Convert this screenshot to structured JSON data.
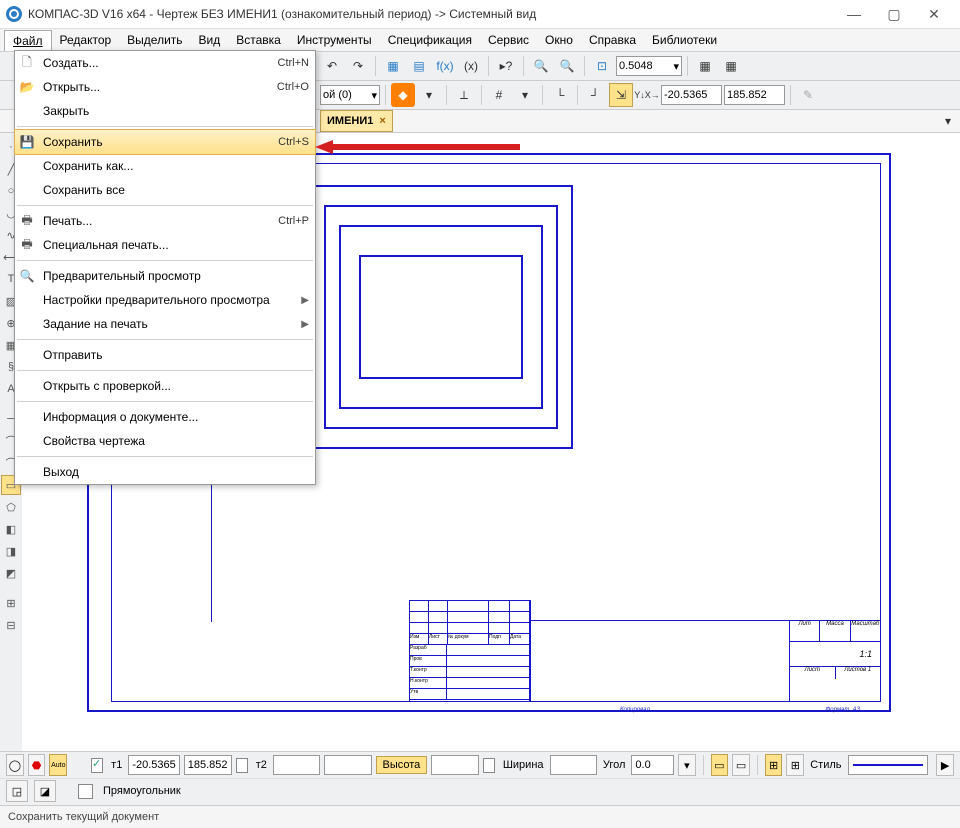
{
  "title": "КОМПАС-3D V16  x64 - Чертеж БЕЗ ИМЕНИ1 (ознакомительный период) -> Системный вид",
  "menu": {
    "file": "Файл",
    "edit": "Редактор",
    "select": "Выделить",
    "view": "Вид",
    "insert": "Вставка",
    "tools": "Инструменты",
    "spec": "Спецификация",
    "service": "Сервис",
    "window": "Окно",
    "help": "Справка",
    "libs": "Библиотеки"
  },
  "dropdown": {
    "create": "Создать...",
    "create_sc": "Ctrl+N",
    "open": "Открыть...",
    "open_sc": "Ctrl+O",
    "close": "Закрыть",
    "save": "Сохранить",
    "save_sc": "Ctrl+S",
    "saveas": "Сохранить как...",
    "saveall": "Сохранить все",
    "print": "Печать...",
    "print_sc": "Ctrl+P",
    "sprint": "Специальная печать...",
    "preview": "Предварительный просмотр",
    "previewset": "Настройки предварительного просмотра",
    "printjob": "Задание на печать",
    "send": "Отправить",
    "openchk": "Открыть с проверкой...",
    "docinfo": "Информация о документе...",
    "props": "Свойства чертежа",
    "exit": "Выход"
  },
  "tab": "ИМЕНИ1",
  "zoom": "0.5048",
  "coord_x": "-20.5365",
  "coord_y": "185.852",
  "bottom": {
    "t1": "т1",
    "t2": "т2",
    "x": "-20.5365",
    "y": "185.852",
    "height": "Высота",
    "width": "Ширина",
    "angle": "Угол",
    "angle_v": "0.0",
    "style": "Стиль",
    "tool": "Прямоугольник"
  },
  "status": "Сохранить текущий документ",
  "toolbar2_label": "ой (0)"
}
